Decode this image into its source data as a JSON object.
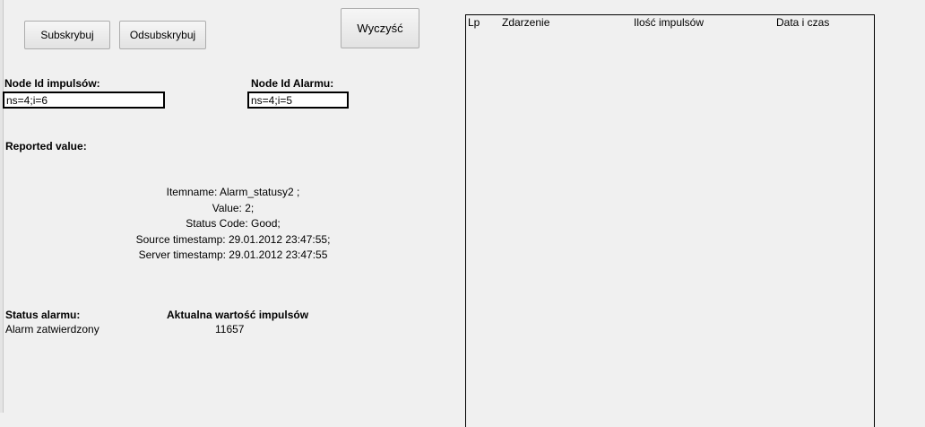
{
  "buttons": {
    "subscribe": "Subskrybuj",
    "unsubscribe": "Odsubskrybuj",
    "clear": "Wyczyść"
  },
  "impulse_node": {
    "label": "Node Id impulsów:",
    "value": "ns=4;i=6"
  },
  "alarm_node": {
    "label": "Node Id Alarmu:",
    "value": "ns=4;i=5"
  },
  "reported": {
    "label": "Reported value:",
    "lines": [
      "Itemname: Alarm_statusy2 ;",
      "Value: 2;",
      "Status Code: Good;",
      "Source timestamp: 29.01.2012 23:47:55;",
      "Server timestamp: 29.01.2012 23:47:55"
    ]
  },
  "alarm_status": {
    "label": "Status alarmu:",
    "value": "Alarm zatwierdzony"
  },
  "impulse_value": {
    "label": "Aktualna wartość impulsów",
    "value": "11657"
  },
  "event_list": {
    "columns": [
      "Lp",
      "Zdarzenie",
      "Ilość impulsów",
      "Data i czas"
    ],
    "rows": []
  }
}
